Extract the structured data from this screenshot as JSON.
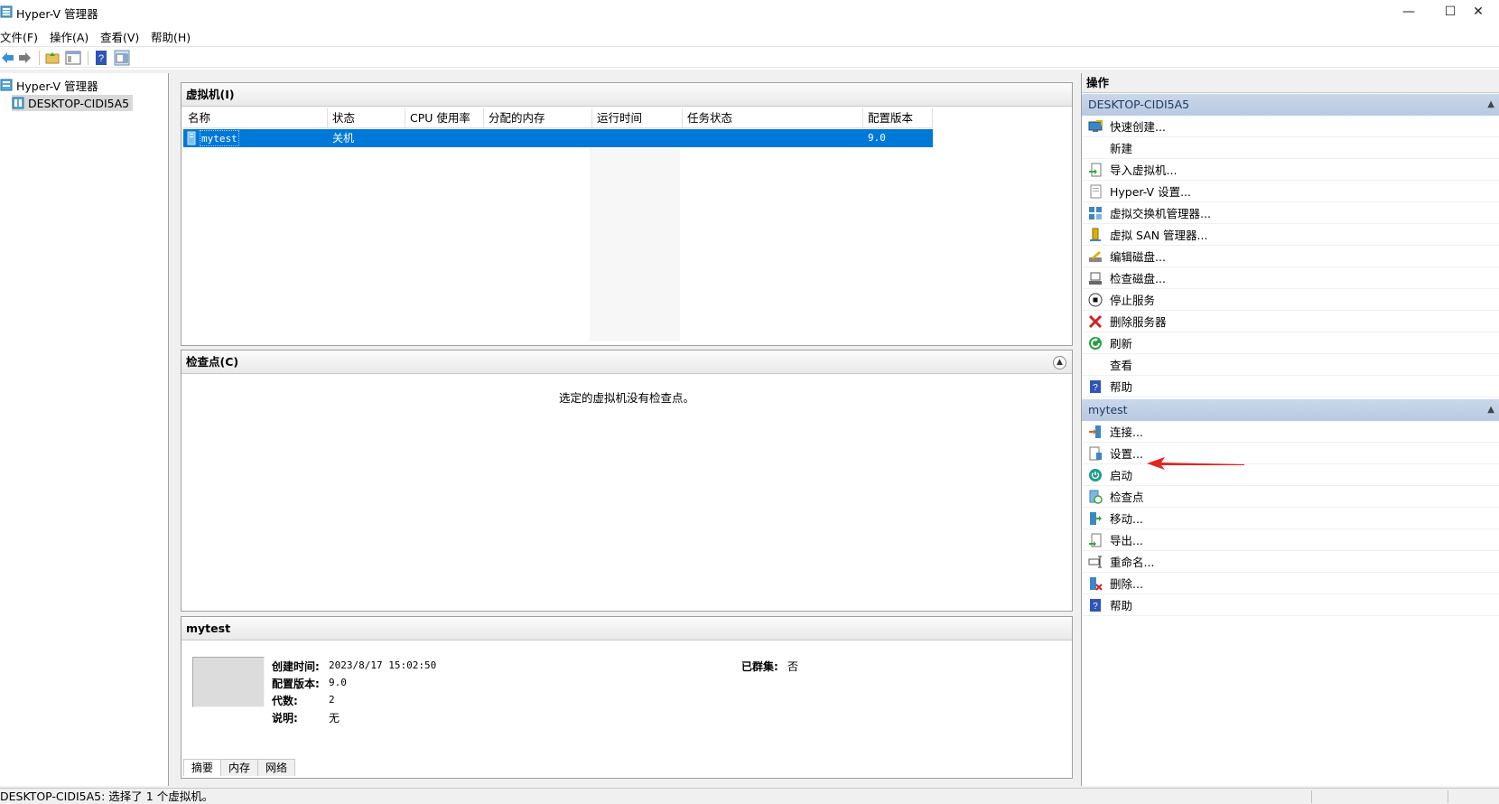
{
  "window": {
    "title": "Hyper-V 管理器",
    "minimize_icon": "minimize-icon",
    "maximize_icon": "maximize-icon",
    "close_icon": "close-icon"
  },
  "menu": [
    {
      "label": "文件(F)"
    },
    {
      "label": "操作(A)"
    },
    {
      "label": "查看(V)"
    },
    {
      "label": "帮助(H)"
    }
  ],
  "toolbar": {
    "icons": [
      "back-arrow-icon",
      "forward-arrow-icon",
      "folder-up-icon",
      "console-tree-icon",
      "help-icon",
      "action-pane-icon"
    ]
  },
  "tree": {
    "root_label": "Hyper-V 管理器",
    "server_label": "DESKTOP-CIDI5A5"
  },
  "vm_panel": {
    "title": "虚拟机(I)",
    "columns": [
      "名称",
      "状态",
      "CPU 使用率",
      "分配的内存",
      "运行时间",
      "任务状态",
      "配置版本"
    ],
    "rows": [
      {
        "name": "mytest",
        "state": "关机",
        "cpu": "",
        "memory": "",
        "uptime": "",
        "task": "",
        "version": "9.0"
      }
    ]
  },
  "checkpoint_panel": {
    "title": "检查点(C)",
    "empty_text": "选定的虚拟机没有检查点。"
  },
  "detail_panel": {
    "title": "mytest",
    "fields": [
      {
        "label": "创建时间:",
        "value": "2023/8/17 15:02:50"
      },
      {
        "label": "配置版本:",
        "value": "9.0"
      },
      {
        "label": "代数:",
        "value": "2"
      },
      {
        "label": "说明:",
        "value": "无"
      }
    ],
    "cluster_label": "已群集:",
    "cluster_value": "否",
    "tabs": [
      "摘要",
      "内存",
      "网络"
    ]
  },
  "actions": {
    "title": "操作",
    "server_group": {
      "header": "DESKTOP-CIDI5A5",
      "items": [
        {
          "label": "快速创建...",
          "icon": "quick-create-icon"
        },
        {
          "label": "新建",
          "icon": ""
        },
        {
          "label": "导入虚拟机...",
          "icon": "import-vm-icon"
        },
        {
          "label": "Hyper-V 设置...",
          "icon": "hyperv-settings-icon"
        },
        {
          "label": "虚拟交换机管理器...",
          "icon": "virtual-switch-icon"
        },
        {
          "label": "虚拟 SAN 管理器...",
          "icon": "virtual-san-icon"
        },
        {
          "label": "编辑磁盘...",
          "icon": "edit-disk-icon"
        },
        {
          "label": "检查磁盘...",
          "icon": "inspect-disk-icon"
        },
        {
          "label": "停止服务",
          "icon": "stop-service-icon"
        },
        {
          "label": "删除服务器",
          "icon": "remove-server-icon"
        },
        {
          "label": "刷新",
          "icon": "refresh-icon"
        },
        {
          "label": "查看",
          "icon": ""
        },
        {
          "label": "帮助",
          "icon": "help-icon"
        }
      ]
    },
    "vm_group": {
      "header": "mytest",
      "items": [
        {
          "label": "连接...",
          "icon": "connect-icon"
        },
        {
          "label": "设置...",
          "icon": "settings-icon"
        },
        {
          "label": "启动",
          "icon": "start-icon"
        },
        {
          "label": "检查点",
          "icon": "checkpoint-icon"
        },
        {
          "label": "移动...",
          "icon": "move-icon"
        },
        {
          "label": "导出...",
          "icon": "export-icon"
        },
        {
          "label": "重命名...",
          "icon": "rename-icon"
        },
        {
          "label": "删除...",
          "icon": "delete-icon"
        },
        {
          "label": "帮助",
          "icon": "help-icon"
        }
      ]
    }
  },
  "status_bar": {
    "text": "DESKTOP-CIDI5A5:  选择了 1 个虚拟机。"
  },
  "colors": {
    "selection": "#0078d7",
    "action_header": "#c9d7ea",
    "annotation_arrow": "#e8231f"
  }
}
